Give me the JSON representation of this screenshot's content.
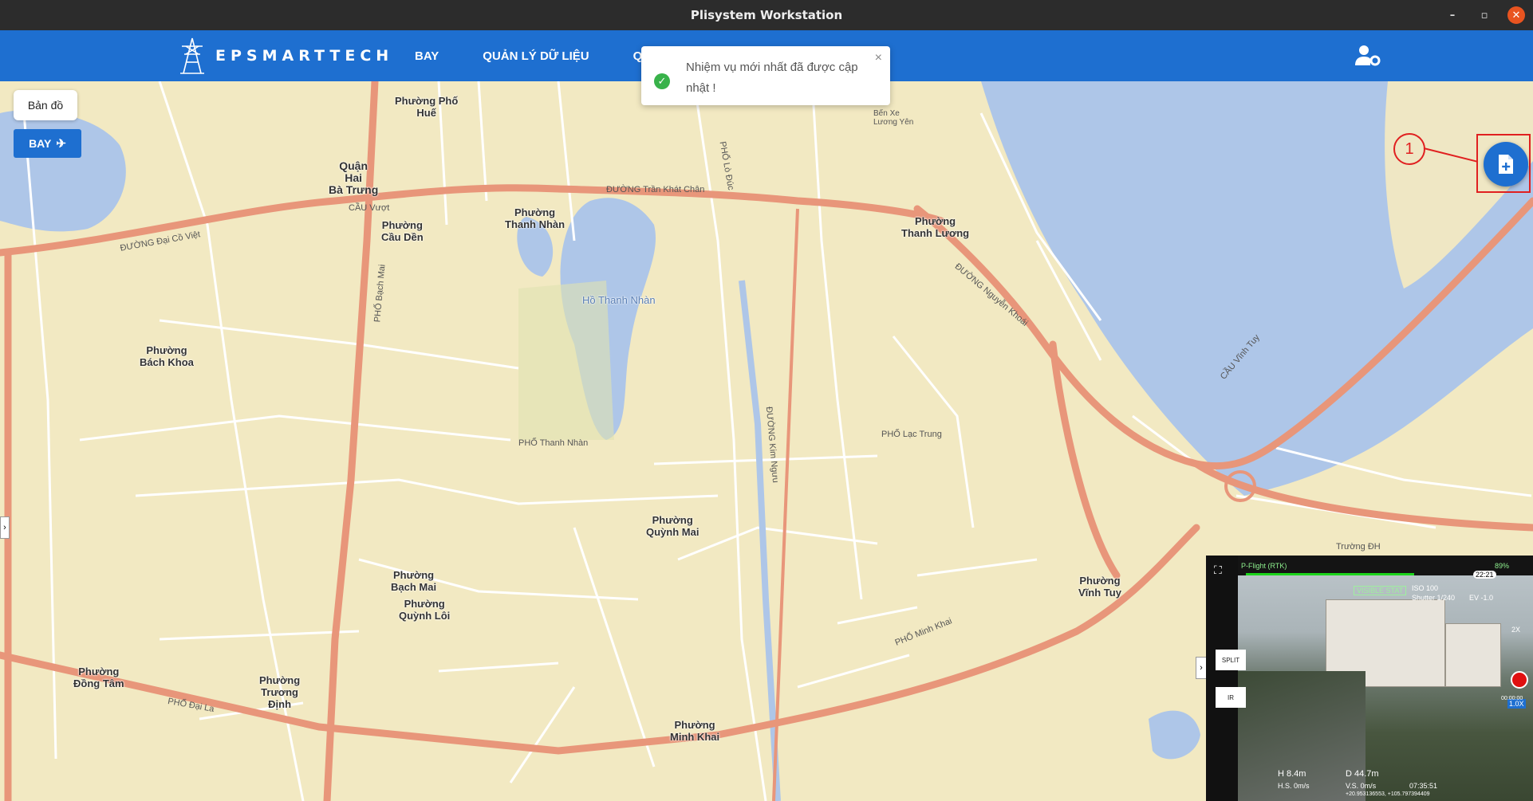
{
  "window": {
    "title": "Plisystem Workstation",
    "controls": [
      "–",
      "▫",
      "✕"
    ]
  },
  "header": {
    "brand": "EPSMARTTECH",
    "nav": [
      "BAY",
      "QUẢN LÝ DỮ LIỆU",
      "QUẢN"
    ],
    "user_settings_icon": "user-cog-icon",
    "colors": {
      "bar": "#1e6fd0"
    }
  },
  "toolbar": {
    "map_button": "Bản đồ",
    "fly_button": "BAY"
  },
  "toast": {
    "message": "Nhiệm vụ mới nhất đã được cập nhật !",
    "close": "×"
  },
  "callout": {
    "label": "1"
  },
  "map": {
    "areas": [
      "Phường Phố\nHuế",
      "Quận\nHai\nBà Trưng",
      "Phường\nThanh Nhàn",
      "Phường\nCầu Dền",
      "Phường\nThanh Lương",
      "Phường\nBách Khoa",
      "Phường\nQuỳnh Mai",
      "Phường\nBạch Mai",
      "Phường\nQuỳnh Lôi",
      "Phường\nVĩnh Tuy",
      "Phường\nĐồng Tâm",
      "Phường\nTrương\nĐịnh",
      "Phường\nMinh Khai"
    ],
    "water": [
      "Hồ Thanh Nhàn"
    ],
    "streets": [
      "ĐƯỜNG Trần Khát Chân",
      "CẦU Vượt",
      "ĐƯỜNG Đại Cồ Việt",
      "PHỐ Lạc Trung",
      "PHỐ Thanh Nhàn",
      "PHỐ Minh Khai",
      "PHỐ Đại La",
      "CẦU Vĩnh Tuy",
      "ĐƯỜNG Nguyễn Khoái",
      "ĐƯỜNG Kim Ngưu",
      "PHỐ Bạch Mai",
      "PHỐ Lò Đúc",
      "Bến Xe\nLương Yên",
      "Trường ĐH"
    ]
  },
  "camera": {
    "mode": "P-Flight (RTK)",
    "time": "22:21",
    "visible_label": "VISIBLE STAT",
    "iso": "ISO 100",
    "shutter": "Shutter 1/240",
    "ev": "EV -1.0",
    "zoom": "2X",
    "zoom_current": "1.0X",
    "rec_time": "00:00:00",
    "battery": "89%",
    "split_button": "SPLIT",
    "ir_button": "IR",
    "altitude": "H 8.4m",
    "distance": "D 44.7m",
    "h_speed": "H.S. 0m/s",
    "v_speed": "V.S. 0m/s",
    "coords": "+20.953136553, +105.797394409",
    "clock": "07:35:51",
    "progress": 0.62
  }
}
